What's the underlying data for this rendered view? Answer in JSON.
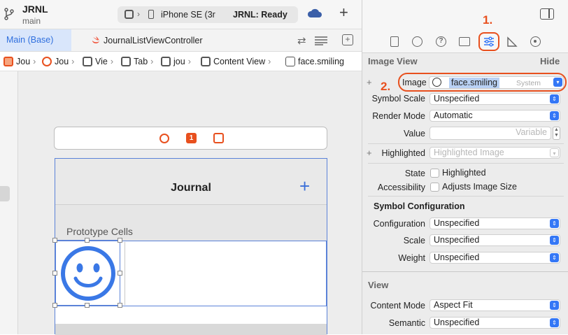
{
  "project": {
    "name": "JRNL",
    "branch": "main"
  },
  "scheme": {
    "device": "iPhone SE (3r",
    "status": "JRNL: Ready"
  },
  "tabs": {
    "main": "Main (Base)",
    "controller": "JournalListViewController"
  },
  "breadcrumb": [
    "Jou",
    "Jou",
    "Vie",
    "Tab",
    "jou",
    "Content View",
    "face.smiling"
  ],
  "scene": {
    "title": "Journal",
    "add": "+",
    "prototype": "Prototype Cells",
    "badge": "1"
  },
  "inspector": {
    "section": "Image View",
    "hide": "Hide",
    "annot1": "1.",
    "annot2": "2.",
    "image": {
      "label": "Image",
      "value": "face.smiling",
      "tag": "System"
    },
    "symbol_scale": {
      "label": "Symbol Scale",
      "value": "Unspecified"
    },
    "render_mode": {
      "label": "Render Mode",
      "value": "Automatic"
    },
    "value": {
      "label": "Value",
      "placeholder": "Variable"
    },
    "highlighted": {
      "label": "Highlighted",
      "placeholder": "Highlighted Image"
    },
    "state": {
      "label": "State",
      "option": "Highlighted"
    },
    "accessibility": {
      "label": "Accessibility",
      "option": "Adjusts Image Size"
    },
    "symbol_config": {
      "header": "Symbol Configuration",
      "configuration": {
        "label": "Configuration",
        "value": "Unspecified"
      },
      "scale": {
        "label": "Scale",
        "value": "Unspecified"
      },
      "weight": {
        "label": "Weight",
        "value": "Unspecified"
      }
    },
    "view": {
      "header": "View",
      "content_mode": {
        "label": "Content Mode",
        "value": "Aspect Fit"
      },
      "semantic": {
        "label": "Semantic",
        "value": "Unspecified"
      }
    },
    "plus": "+"
  },
  "colors": {
    "accent": "#3477f6",
    "annotation": "#e8501e",
    "selection": "#4a7de0"
  }
}
